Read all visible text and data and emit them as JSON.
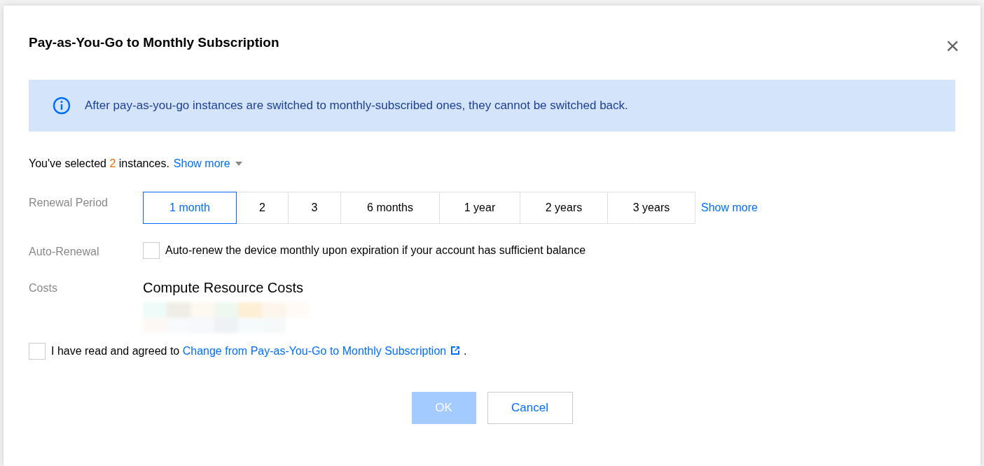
{
  "dialog": {
    "title": "Pay-as-You-Go to Monthly Subscription",
    "close": "×"
  },
  "alert": {
    "text": "After pay-as-you-go instances are switched to monthly-subscribed ones, they cannot be switched back."
  },
  "selection": {
    "prefix": "You've selected",
    "count": "2",
    "suffix": "instances.",
    "toggle": "Show more",
    "expanded": false
  },
  "renewal_period": {
    "label": "Renewal Period",
    "options": [
      {
        "label": "1 month",
        "selected": true
      },
      {
        "label": "2",
        "selected": false
      },
      {
        "label": "3",
        "selected": false
      },
      {
        "label": "6 months",
        "selected": false
      },
      {
        "label": "1 year",
        "selected": false
      },
      {
        "label": "2 years",
        "selected": false
      },
      {
        "label": "3 years",
        "selected": false
      }
    ],
    "more": "Show more"
  },
  "auto_renewal": {
    "label": "Auto-Renewal",
    "text": "Auto-renew the device monthly upon expiration if your account has sufficient balance",
    "checked": false
  },
  "costs": {
    "label": "Costs",
    "heading": "Compute Resource Costs"
  },
  "agreement": {
    "prefix": "I have read and agreed to",
    "link": "Change from Pay-as-You-Go to Monthly Subscription",
    "suffix": ".",
    "checked": false
  },
  "buttons": [
    {
      "label": "OK",
      "kind": "primary",
      "disabled": true
    },
    {
      "label": "Cancel",
      "kind": "secondary",
      "disabled": false
    }
  ]
}
